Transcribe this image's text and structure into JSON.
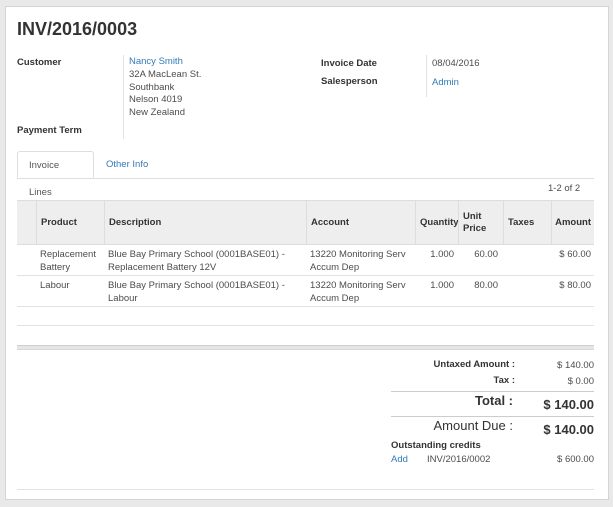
{
  "invoice": {
    "number": "INV/2016/0003"
  },
  "customer": {
    "label": "Customer",
    "name": "Nancy Smith",
    "address": [
      "32A MacLean St.",
      "Southbank",
      "Nelson 4019",
      "New Zealand"
    ]
  },
  "payment_term": {
    "label": "Payment Term"
  },
  "invoice_date": {
    "label": "Invoice Date",
    "value": "08/04/2016"
  },
  "salesperson": {
    "label": "Salesperson",
    "value": "Admin"
  },
  "tabs": [
    {
      "label": "Invoice Lines",
      "active": true
    },
    {
      "label": "Other Info",
      "active": false
    }
  ],
  "pager": "1-2 of 2",
  "table": {
    "columns": {
      "product": "Product",
      "description": "Description",
      "account": "Account",
      "quantity": "Quantity",
      "unit_price_1": "Unit",
      "unit_price_2": "Price",
      "taxes": "Taxes",
      "amount": "Amount"
    },
    "rows": [
      {
        "product": [
          "Replacement",
          "Battery"
        ],
        "description": [
          "Blue Bay Primary School (0001BASE01) -",
          "Replacement Battery 12V"
        ],
        "account": [
          "13220 Monitoring Serv",
          "Accum Dep"
        ],
        "quantity": "1.000",
        "unit_price": "60.00",
        "taxes": "",
        "amount": "$ 60.00"
      },
      {
        "product": [
          "Labour"
        ],
        "description": [
          "Blue Bay Primary School (0001BASE01) -",
          "Labour"
        ],
        "account": [
          "13220 Monitoring Serv",
          "Accum Dep"
        ],
        "quantity": "1.000",
        "unit_price": "80.00",
        "taxes": "",
        "amount": "$ 80.00"
      }
    ]
  },
  "totals": {
    "untaxed_label": "Untaxed Amount :",
    "untaxed_value": "$ 140.00",
    "tax_label": "Tax :",
    "tax_value": "$ 0.00",
    "total_label": "Total :",
    "total_value": "$ 140.00",
    "due_label": "Amount Due :",
    "due_value": "$ 140.00"
  },
  "credits": {
    "title": "Outstanding credits",
    "items": [
      {
        "action": "Add",
        "ref": "INV/2016/0002",
        "amount": "$ 600.00"
      }
    ]
  },
  "colors": {
    "link": "#337ab7",
    "header_bg": "#eeeeee",
    "text": "#4c4c4c"
  }
}
